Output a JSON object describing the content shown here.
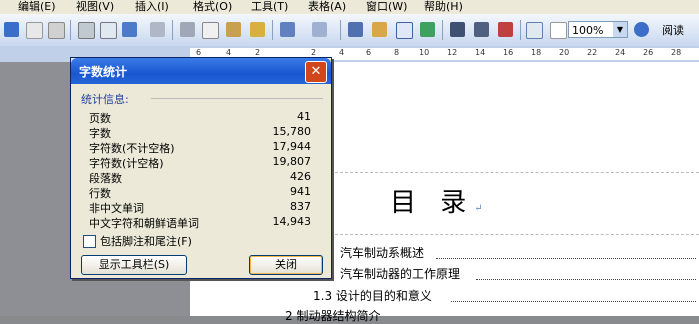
{
  "menu": [
    "编辑(E)",
    "视图(V)",
    "插入(I)",
    "格式(O)",
    "工具(T)",
    "表格(A)",
    "窗口(W)",
    "帮助(H)"
  ],
  "toolbar": {
    "zoom": "100%",
    "read_label": "阅读"
  },
  "ruler": [
    "6",
    "4",
    "2",
    "2",
    "4",
    "6",
    "8",
    "10",
    "12",
    "14",
    "16",
    "18",
    "20",
    "22",
    "24",
    "26",
    "28"
  ],
  "document": {
    "title": "目 录",
    "toc": [
      {
        "text": "汽车制动系概述"
      },
      {
        "text": "汽车制动器的工作原理"
      },
      {
        "text": "1.3 设计的目的和意义"
      },
      {
        "text": "2 制动器结构简介"
      }
    ]
  },
  "dialog": {
    "title": "字数统计",
    "section_label": "统计信息:",
    "stats": [
      {
        "label": "页数",
        "value": "41"
      },
      {
        "label": "字数",
        "value": "15,780"
      },
      {
        "label": "字符数(不计空格)",
        "value": "17,944"
      },
      {
        "label": "字符数(计空格)",
        "value": "19,807"
      },
      {
        "label": "段落数",
        "value": "426"
      },
      {
        "label": "行数",
        "value": "941"
      },
      {
        "label": "非中文单词",
        "value": "837"
      },
      {
        "label": "中文字符和朝鲜语单词",
        "value": "14,943"
      }
    ],
    "checkbox_label": "包括脚注和尾注(F)",
    "show_toolbar_button": "显示工具栏(S)",
    "close_button": "关闭"
  },
  "colors": {
    "title_bar": "#2564d8",
    "close": "#d2461b",
    "section": "#1d3f9b"
  }
}
